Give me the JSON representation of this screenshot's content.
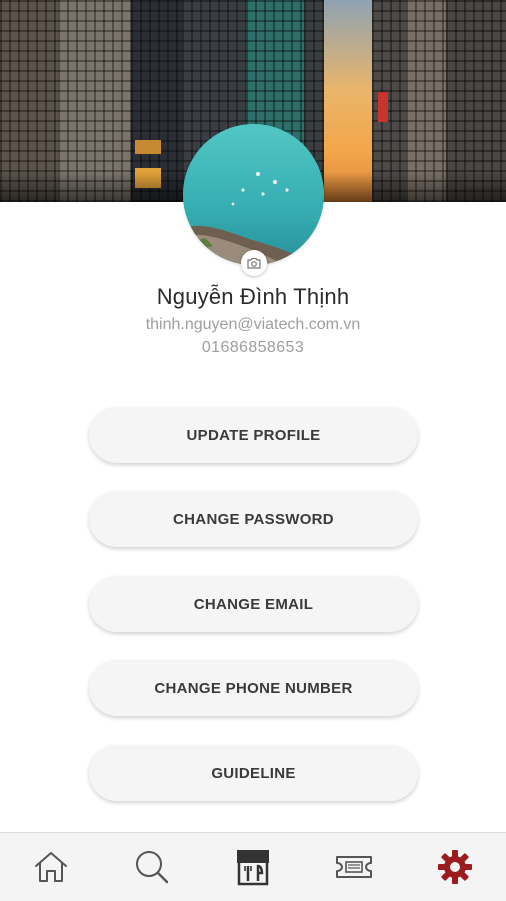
{
  "profile": {
    "name": "Nguyễn Đình Thịnh",
    "email": "thinh.nguyen@viatech.com.vn",
    "phone": "01686858653"
  },
  "actions": {
    "update_profile": "UPDATE PROFILE",
    "change_password": "CHANGE PASSWORD",
    "change_email": "CHANGE EMAIL",
    "change_phone": "CHANGE PHONE NUMBER",
    "guideline": "GUIDELINE"
  },
  "nav": {
    "items": [
      {
        "icon": "home-icon",
        "active": false
      },
      {
        "icon": "search-icon",
        "active": false
      },
      {
        "icon": "store-icon",
        "active": false
      },
      {
        "icon": "ticket-icon",
        "active": false
      },
      {
        "icon": "gear-icon",
        "active": true
      }
    ]
  },
  "colors": {
    "accent": "#9b1b1f",
    "nav_icon": "#555555",
    "button_bg": "#f5f5f6",
    "secondary_text": "#9e9e9e"
  }
}
